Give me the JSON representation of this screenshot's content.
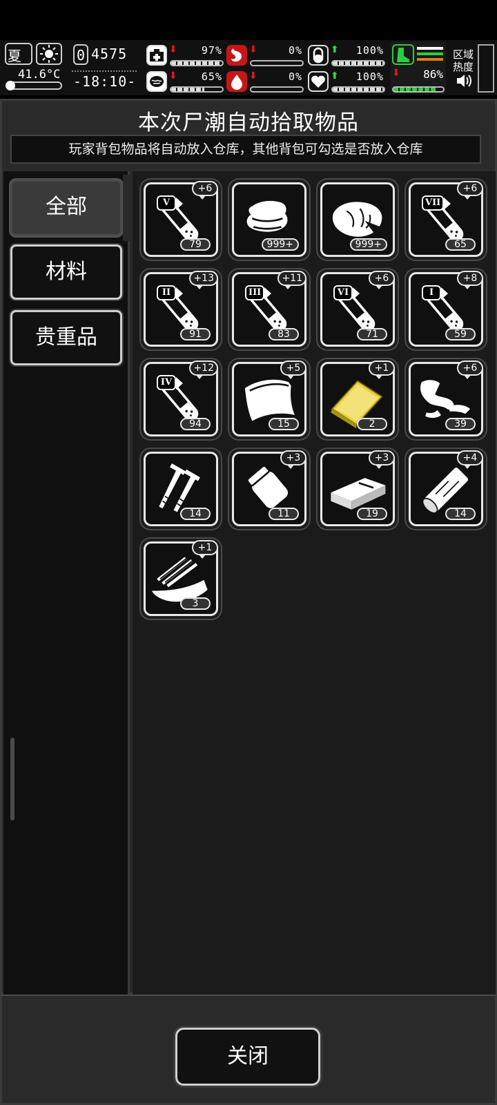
{
  "hud": {
    "season": "夏",
    "temperature": "41.6°C",
    "day_counter": "0",
    "score": "4575",
    "clock": "-18:10-",
    "zone_heat_label_1": "区域",
    "zone_heat_label_2": "热度",
    "stats": [
      {
        "icon": "medkit-icon",
        "trend": "down",
        "value": "97%",
        "fraction": 0.97
      },
      {
        "icon": "stomach-icon",
        "trend": "down",
        "value": "0%",
        "fraction": 0.0
      },
      {
        "icon": "pill-icon",
        "trend": "up",
        "value": "100%",
        "fraction": 1.0
      },
      {
        "icon": "brain-icon",
        "trend": "down",
        "value": "65%",
        "fraction": 0.65
      },
      {
        "icon": "blood-drop-icon",
        "trend": "down",
        "value": "0%",
        "fraction": 0.0
      },
      {
        "icon": "heart-icon",
        "trend": "up",
        "value": "100%",
        "fraction": 1.0
      }
    ],
    "stamina": {
      "icon": "boot-icon",
      "trend": "down",
      "value": "86%",
      "fraction": 0.86
    }
  },
  "panel": {
    "title": "本次尸潮自动拾取物品",
    "subtitle": "玩家背包物品将自动放入仓库，其他背包可勾选是否放入仓库"
  },
  "categories": [
    {
      "label": "全部",
      "active": true
    },
    {
      "label": "材料",
      "active": false
    },
    {
      "label": "贵重品",
      "active": false
    }
  ],
  "items": [
    {
      "icon": "test-tube-icon",
      "tier": "V",
      "plus": "+6",
      "count": "79"
    },
    {
      "icon": "cloth-icon",
      "tier": "",
      "plus": "",
      "count": "999+"
    },
    {
      "icon": "meat-icon",
      "tier": "",
      "plus": "",
      "count": "999+"
    },
    {
      "icon": "test-tube-icon",
      "tier": "VII",
      "plus": "+6",
      "count": "65"
    },
    {
      "icon": "test-tube-icon",
      "tier": "II",
      "plus": "+13",
      "count": "91"
    },
    {
      "icon": "test-tube-icon",
      "tier": "III",
      "plus": "+11",
      "count": "83"
    },
    {
      "icon": "test-tube-icon",
      "tier": "VI",
      "plus": "+6",
      "count": "71"
    },
    {
      "icon": "test-tube-icon",
      "tier": "I",
      "plus": "+8",
      "count": "59"
    },
    {
      "icon": "test-tube-icon",
      "tier": "IV",
      "plus": "+12",
      "count": "94"
    },
    {
      "icon": "bandage-icon",
      "tier": "",
      "plus": "+5",
      "count": "15"
    },
    {
      "icon": "gold-bar-icon",
      "tier": "",
      "plus": "+1",
      "count": "2"
    },
    {
      "icon": "scrap-cloth-icon",
      "tier": "",
      "plus": "+6",
      "count": "39"
    },
    {
      "icon": "nails-icon",
      "tier": "",
      "plus": "",
      "count": "14"
    },
    {
      "icon": "bag-icon",
      "tier": "",
      "plus": "+3",
      "count": "11"
    },
    {
      "icon": "brick-icon",
      "tier": "",
      "plus": "+3",
      "count": "19"
    },
    {
      "icon": "log-icon",
      "tier": "",
      "plus": "+4",
      "count": "14"
    },
    {
      "icon": "wood-bowl-icon",
      "tier": "",
      "plus": "+1",
      "count": "3"
    }
  ],
  "close_label": "关闭",
  "colors": {
    "accent_green": "#2fcc3f",
    "alert_red": "#e01919",
    "gold": "#e8d23a"
  }
}
